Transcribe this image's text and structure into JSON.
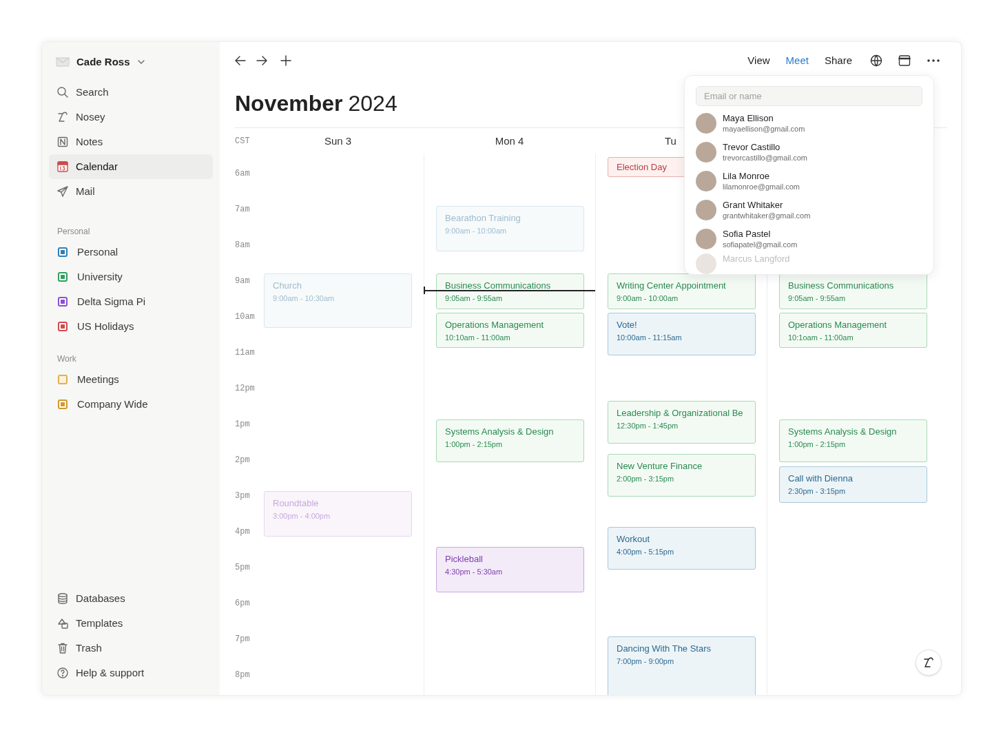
{
  "sidebar": {
    "account": {
      "name": "Cade Ross"
    },
    "nav": [
      {
        "label": "Search",
        "selected": false
      },
      {
        "label": "Nosey",
        "selected": false
      },
      {
        "label": "Notes",
        "selected": false
      },
      {
        "label": "Calendar",
        "selected": true
      },
      {
        "label": "Mail",
        "selected": false
      }
    ],
    "sections": [
      {
        "title": "Personal",
        "items": [
          {
            "label": "Personal",
            "color": "#2e7fb5",
            "kind": "dot"
          },
          {
            "label": "University",
            "color": "#2f9e5e",
            "kind": "dot"
          },
          {
            "label": "Delta Sigma Pi",
            "color": "#8a4fd6",
            "kind": "dot"
          },
          {
            "label": "US Holidays",
            "color": "#d04a4a",
            "kind": "dot"
          }
        ]
      },
      {
        "title": "Work",
        "items": [
          {
            "label": "Meetings",
            "color": "#e0b050",
            "kind": "plain"
          },
          {
            "label": "Company Wide",
            "color": "#d09a30",
            "kind": "dot"
          }
        ]
      }
    ],
    "footer": [
      {
        "label": "Databases"
      },
      {
        "label": "Templates"
      },
      {
        "label": "Trash"
      },
      {
        "label": "Help & support"
      }
    ]
  },
  "toolbar": {
    "tabs": [
      {
        "label": "View",
        "selected": false
      },
      {
        "label": "Meet",
        "selected": true
      },
      {
        "label": "Share",
        "selected": false
      }
    ]
  },
  "title": {
    "month": "November",
    "year": "2024"
  },
  "calendar": {
    "timezone": "CST",
    "hours": [
      "6am",
      "7am",
      "8am",
      "9am",
      "10am",
      "11am",
      "12pm",
      "1pm",
      "2pm",
      "3pm",
      "4pm",
      "5pm",
      "6pm",
      "7pm",
      "8pm"
    ],
    "days": [
      {
        "label": "Sun 3",
        "events": [
          {
            "title": "Church",
            "time": "9:00am - 10:30am",
            "kind": "personal",
            "faded": true
          },
          {
            "title": "Roundtable",
            "time": "3:00pm - 4:00pm",
            "kind": "delta",
            "faded": true
          }
        ]
      },
      {
        "label": "Mon 4",
        "events": [
          {
            "title": "Bearathon Training",
            "time": "9:00am - 10:00am",
            "kind": "personal",
            "faded": true
          },
          {
            "title": "Business Communications",
            "time": "9:05am - 9:55am",
            "kind": "university",
            "faded": false
          },
          {
            "title": "Operations Management",
            "time": "10:10am - 11:00am",
            "kind": "university",
            "faded": false
          },
          {
            "title": "Systems Analysis & Design",
            "time": "1:00pm - 2:15pm",
            "kind": "university",
            "faded": false
          },
          {
            "title": "Pickleball",
            "time": "4:30pm - 5:30am",
            "kind": "delta",
            "faded": false
          }
        ]
      },
      {
        "label": "Tu",
        "events": [
          {
            "title": "Election Day",
            "kind": "holiday",
            "faded": false
          },
          {
            "title": "Writing Center Appointment",
            "time": "9:00am - 10:00am",
            "kind": "university",
            "faded": false
          },
          {
            "title": "Vote!",
            "time": "10:00am - 11:15am",
            "kind": "personal",
            "faded": false
          },
          {
            "title": "Leadership & Organizational Be",
            "time": "12:30pm - 1:45pm",
            "kind": "university",
            "faded": false
          },
          {
            "title": "New Venture Finance",
            "time": "2:00pm - 3:15pm",
            "kind": "university",
            "faded": false
          },
          {
            "title": "Workout",
            "time": "4:00pm - 5:15pm",
            "kind": "personal",
            "faded": false
          },
          {
            "title": "Dancing With The Stars",
            "time": "7:00pm - 9:00pm",
            "kind": "personal",
            "faded": false
          }
        ]
      },
      {
        "events": [
          {
            "title": "Business Communications",
            "time": "9:05am - 9:55am",
            "kind": "university",
            "faded": false
          },
          {
            "title": "Operations Management",
            "time": "10:1oam - 11:00am",
            "kind": "university",
            "faded": false
          },
          {
            "title": "Systems Analysis & Design",
            "time": "1:00pm - 2:15pm",
            "kind": "university",
            "faded": false
          },
          {
            "title": "Call with Dienna",
            "time": "2:30pm - 3:15pm",
            "kind": "personal",
            "faded": false
          }
        ]
      }
    ]
  },
  "meet_popup": {
    "search": {
      "placeholder": "Email or name"
    },
    "contacts": [
      {
        "name": "Maya Ellison",
        "email": "mayaellison@gmail.com",
        "faded": false
      },
      {
        "name": "Trevor Castillo",
        "email": "trevorcastillo@gmail.com",
        "faded": false
      },
      {
        "name": "Lila Monroe",
        "email": "lilamonroe@gmail.com",
        "faded": false
      },
      {
        "name": "Grant Whitaker",
        "email": "grantwhitaker@gmail.com",
        "faded": false
      },
      {
        "name": "Sofia Pastel",
        "email": "sofiapatel@gmail.com",
        "faded": false
      },
      {
        "name": "Marcus Langford",
        "faded": true
      }
    ]
  }
}
